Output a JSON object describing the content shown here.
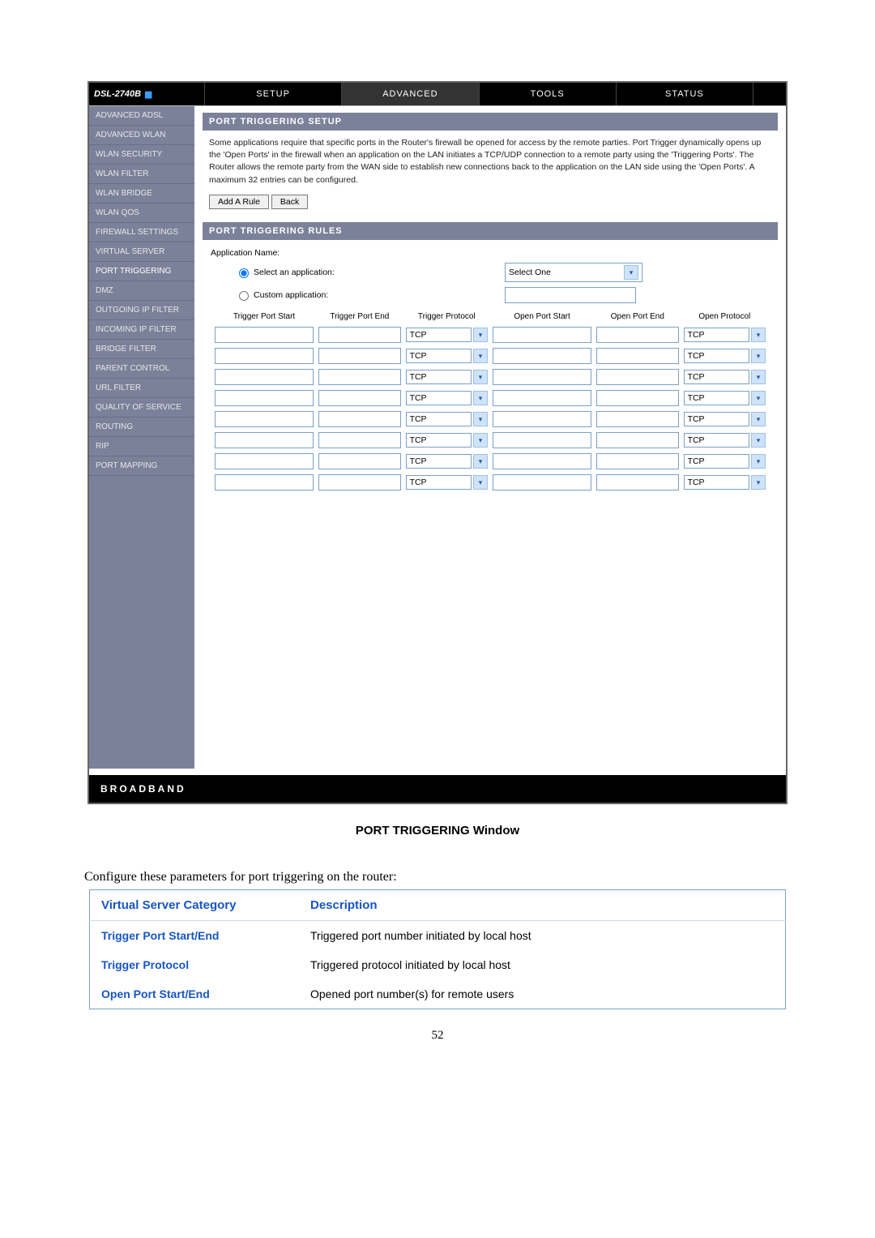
{
  "model": "DSL-2740B",
  "tabs": [
    "SETUP",
    "ADVANCED",
    "TOOLS",
    "STATUS"
  ],
  "sidebar": [
    "ADVANCED ADSL",
    "ADVANCED WLAN",
    "WLAN SECURITY",
    "WLAN FILTER",
    "WLAN BRIDGE",
    "WLAN QOS",
    "FIREWALL SETTINGS",
    "VIRTUAL SERVER",
    "PORT TRIGGERING",
    "DMZ",
    "OUTGOING IP FILTER",
    "INCOMING IP FILTER",
    "BRIDGE FILTER",
    "PARENT CONTROL",
    "URL FILTER",
    "QUALITY OF SERVICE",
    "ROUTING",
    "RIP",
    "PORT MAPPING"
  ],
  "panel1": {
    "title": "PORT TRIGGERING SETUP",
    "text": "Some applications require that specific ports in the Router's firewall be opened for access by the remote parties. Port Trigger dynamically opens up the 'Open Ports' in the firewall when an application on the LAN initiates a TCP/UDP connection to a remote party using the 'Triggering Ports'. The Router allows the remote party from the WAN side to establish new connections back to the application on the LAN side using the 'Open Ports'. A maximum 32 entries can be configured.",
    "btn_add": "Add A Rule",
    "btn_back": "Back"
  },
  "panel2": {
    "title": "PORT TRIGGERING RULES",
    "app_label": "Application Name:",
    "radio_select": "Select an application:",
    "radio_custom": "Custom application:",
    "select_value": "Select One",
    "headers": [
      "Trigger Port Start",
      "Trigger Port End",
      "Trigger Protocol",
      "Open Port Start",
      "Open Port End",
      "Open Protocol"
    ],
    "proto_default": "TCP",
    "row_count": 8
  },
  "footer": "BROADBAND",
  "caption": "PORT TRIGGERING Window",
  "intro": "Configure these parameters for port triggering on the router:",
  "desc": {
    "head1": "Virtual Server Category",
    "head2": "Description",
    "rows": [
      {
        "k": "Trigger Port Start/End",
        "v": "Triggered port number initiated by local host"
      },
      {
        "k": "Trigger Protocol",
        "v": "Triggered protocol initiated by local host"
      },
      {
        "k": "Open Port Start/End",
        "v": "Opened port number(s) for remote users"
      }
    ]
  },
  "pagenum": "52"
}
